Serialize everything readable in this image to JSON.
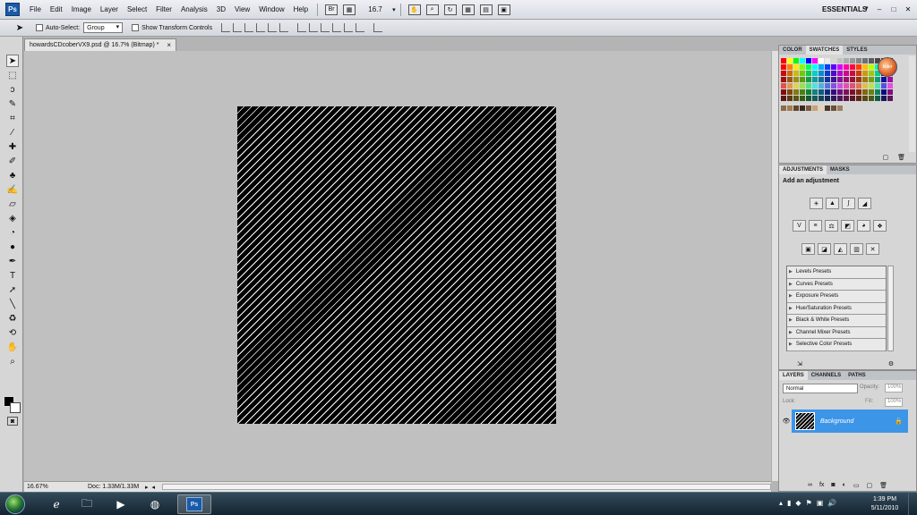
{
  "app": {
    "logo": "Ps",
    "workspace": "ESSENTIALS"
  },
  "menu": [
    "File",
    "Edit",
    "Image",
    "Layer",
    "Select",
    "Filter",
    "Analysis",
    "3D",
    "View",
    "Window",
    "Help"
  ],
  "toolbar": {
    "zoom_value": "16.7"
  },
  "options": {
    "auto_select_label": "Auto-Select:",
    "auto_select_value": "Group",
    "transform_label": "Show Transform Controls"
  },
  "document": {
    "tab_title": "howardsCDcoberVX9.psd @ 16.7% (Bitmap) *",
    "close": "×"
  },
  "status": {
    "zoom": "16.67%",
    "doc_size": "Doc: 1.33M/1.33M"
  },
  "swatches_panel": {
    "tabs": [
      "COLOR",
      "SWATCHES",
      "STYLES"
    ],
    "active": "SWATCHES"
  },
  "adjustments_panel": {
    "tabs": [
      "ADJUSTMENTS",
      "MASKS"
    ],
    "title": "Add an adjustment",
    "presets": [
      "Levels Presets",
      "Curves Presets",
      "Exposure Presets",
      "Hue/Saturation Presets",
      "Black & White Presets",
      "Channel Mixer Presets",
      "Selective Color Presets"
    ]
  },
  "layers_panel": {
    "tabs": [
      "LAYERS",
      "CHANNELS",
      "PATHS"
    ],
    "blend_mode": "Normal",
    "opacity_label": "Opacity:",
    "opacity_value": "100%",
    "lock_label": "Lock:",
    "fill_label": "Fill:",
    "fill_value": "100%",
    "layer_name": "Background"
  },
  "taskbar": {
    "time": "1:39 PM",
    "date": "5/11/2010",
    "ps_label": "Ps"
  },
  "colors": {
    "layer_selected": "#3d95e8",
    "canvas_bg": "#000000",
    "stripe": "#ffffff",
    "workspace_bg": "#c0c0c0"
  }
}
